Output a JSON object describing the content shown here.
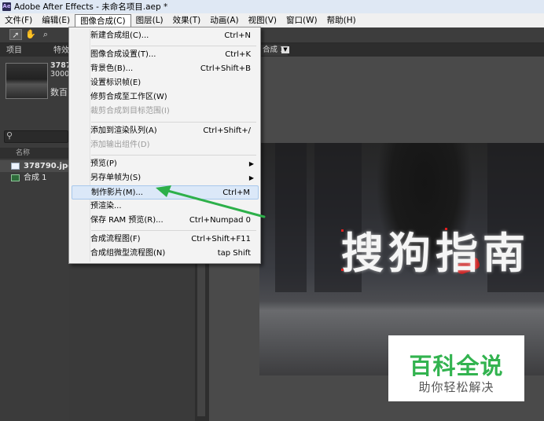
{
  "window": {
    "title": "Adobe After Effects - 未命名项目.aep *",
    "icon": "Ae"
  },
  "menubar": {
    "items": [
      {
        "label": "文件(F)"
      },
      {
        "label": "编辑(E)"
      },
      {
        "label": "图像合成(C)"
      },
      {
        "label": "图层(L)"
      },
      {
        "label": "效果(T)"
      },
      {
        "label": "动画(A)"
      },
      {
        "label": "视图(V)"
      },
      {
        "label": "窗口(W)"
      },
      {
        "label": "帮助(H)"
      }
    ]
  },
  "toolbar": {
    "tools": [
      "selection-arrow-icon",
      "hand-icon",
      "zoom-icon"
    ]
  },
  "project_panel": {
    "tab_project": "项目",
    "tab_effects": "特效",
    "meta_name": "3787",
    "meta_size": "3000",
    "meta_desc": "数百",
    "column_name": "名称",
    "rows": [
      {
        "label": "378790.jpg",
        "icon": "image-file-icon"
      },
      {
        "label": "合成 1",
        "icon": "composition-icon"
      }
    ]
  },
  "composition_panel": {
    "tab_label": "合成 1",
    "text_layer": "搜狗指南"
  },
  "watermark": {
    "main": "百科全说",
    "sub": "助你轻松解决"
  },
  "dropdown": {
    "items": [
      {
        "label": "新建合成组(C)...",
        "shortcut": "Ctrl+N"
      },
      {
        "label": "图像合成设置(T)...",
        "shortcut": "Ctrl+K"
      },
      {
        "label": "背景色(B)...",
        "shortcut": "Ctrl+Shift+B"
      },
      {
        "label": "设置标识帧(E)",
        "shortcut": ""
      },
      {
        "label": "修剪合成至工作区(W)",
        "shortcut": ""
      },
      {
        "label": "裁剪合成到目标范围(I)",
        "shortcut": "",
        "disabled": true
      },
      {
        "label": "添加到渲染队列(A)",
        "shortcut": "Ctrl+Shift+/"
      },
      {
        "label": "添加输出组件(D)",
        "shortcut": "",
        "disabled": true
      },
      {
        "label": "预览(P)",
        "shortcut": "",
        "submenu": true
      },
      {
        "label": "另存单帧为(S)",
        "shortcut": "",
        "submenu": true
      },
      {
        "label": "制作影片(M)...",
        "shortcut": "Ctrl+M",
        "highlighted": true
      },
      {
        "label": "预渲染...",
        "shortcut": ""
      },
      {
        "label": "保存 RAM 预览(R)...",
        "shortcut": "Ctrl+Numpad 0"
      },
      {
        "label": "合成流程图(F)",
        "shortcut": "Ctrl+Shift+F11"
      },
      {
        "label": "合成组微型流程图(N)",
        "shortcut": "tap Shift"
      }
    ]
  },
  "annotation": {
    "arrow_color": "#2db04a"
  }
}
